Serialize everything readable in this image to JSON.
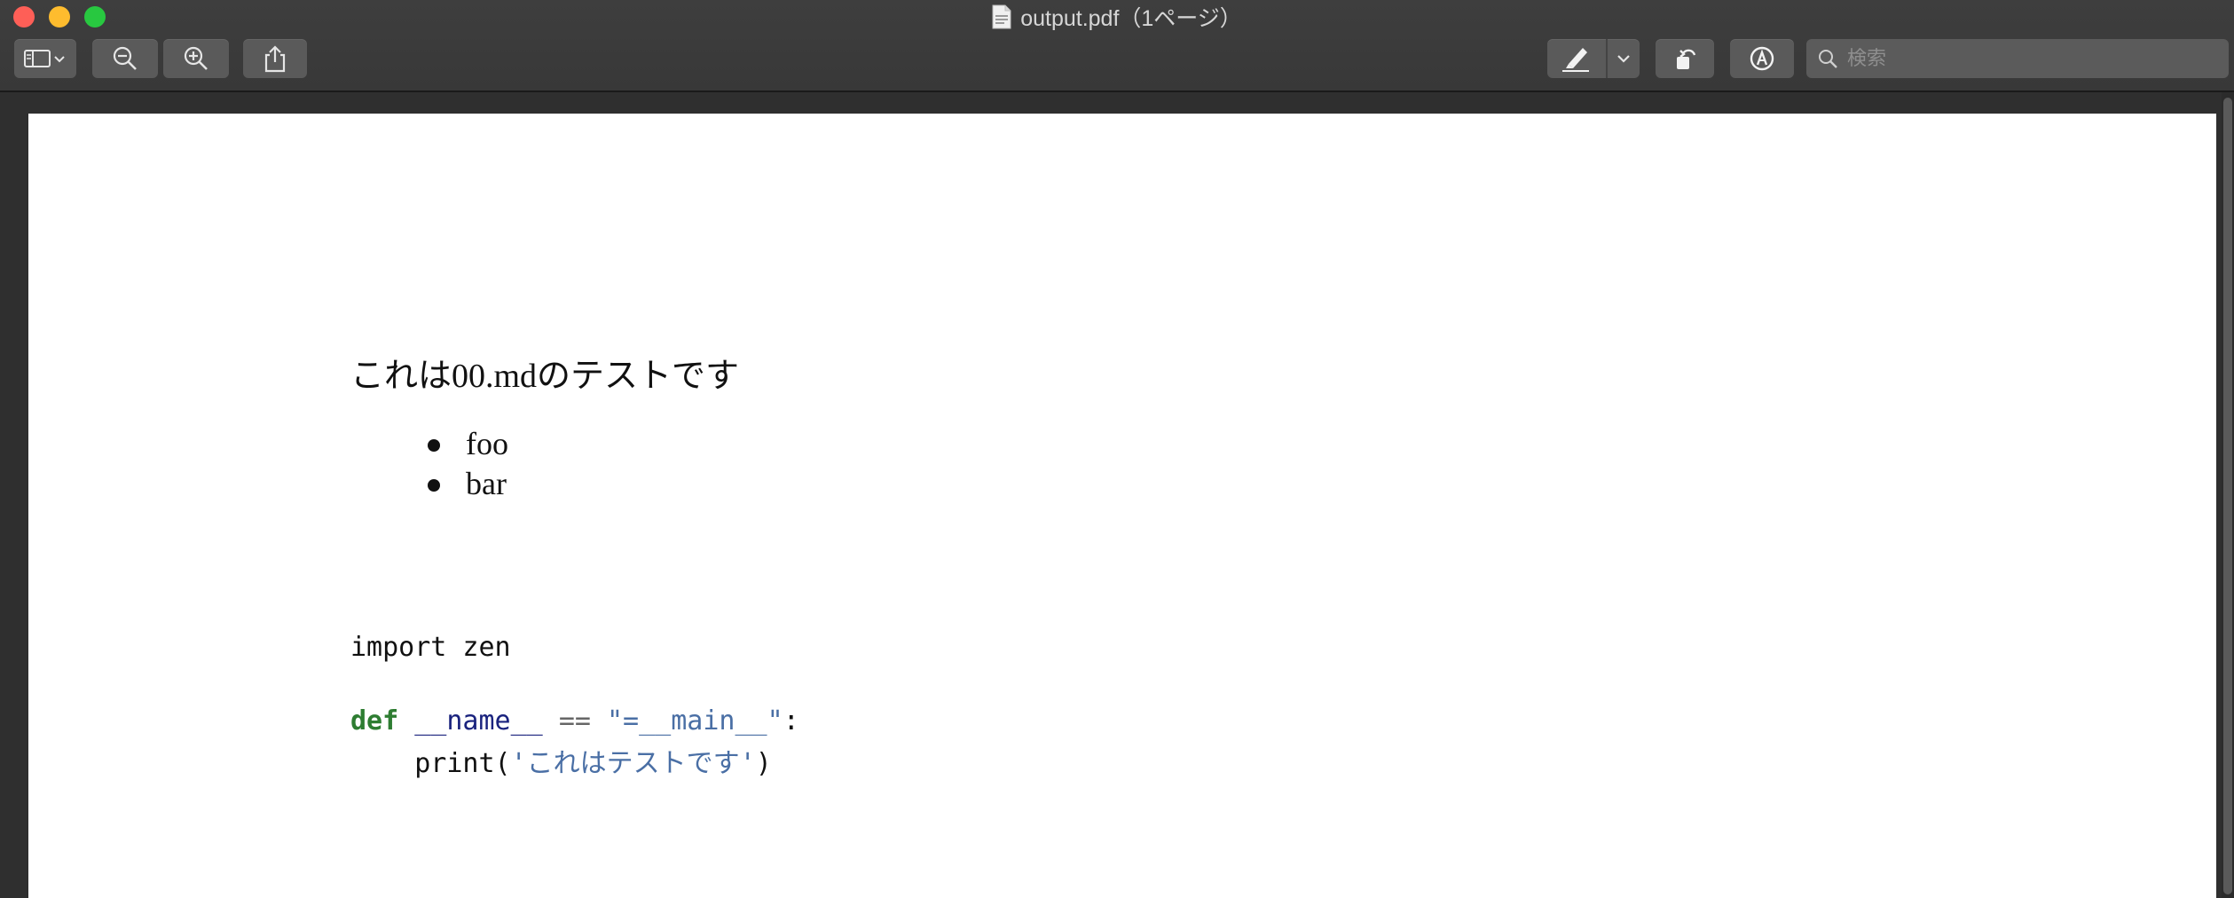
{
  "window": {
    "title": "output.pdf（1ページ）"
  },
  "toolbar": {
    "search_placeholder": "検索"
  },
  "document": {
    "heading": "これは00.mdのテストです",
    "bullets": [
      "foo",
      "bar"
    ],
    "code": {
      "line1": "import zen",
      "line2_kw": "def",
      "line2_name": "__name__",
      "line2_op": "==",
      "line2_str": "\"=__main__\"",
      "line2_colon": ":",
      "line3_print": "print(",
      "line3_str": "'これはテストです'",
      "line3_close": ")"
    }
  },
  "colors": {
    "keyword": "#2e7d32",
    "name": "#1a237e",
    "string": "#4a6fa5"
  }
}
